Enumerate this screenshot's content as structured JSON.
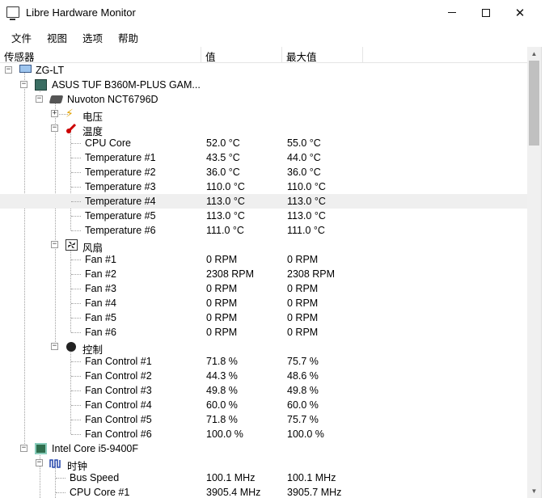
{
  "window": {
    "title": "Libre Hardware Monitor"
  },
  "menu": [
    "文件",
    "视图",
    "选项",
    "帮助"
  ],
  "columns": {
    "sensor": "传感器",
    "value": "值",
    "max": "最大值"
  },
  "tree": {
    "root": "ZG-LT",
    "motherboard": "ASUS TUF B360M-PLUS GAM...",
    "superio": "Nuvoton NCT6796D",
    "voltage_group": "电压",
    "temp_group": "温度",
    "temps": [
      {
        "name": "CPU Core",
        "value": "52.0 °C",
        "max": "55.0 °C"
      },
      {
        "name": "Temperature #1",
        "value": "43.5 °C",
        "max": "44.0 °C"
      },
      {
        "name": "Temperature #2",
        "value": "36.0 °C",
        "max": "36.0 °C"
      },
      {
        "name": "Temperature #3",
        "value": "110.0 °C",
        "max": "110.0 °C"
      },
      {
        "name": "Temperature #4",
        "value": "113.0 °C",
        "max": "113.0 °C"
      },
      {
        "name": "Temperature #5",
        "value": "113.0 °C",
        "max": "113.0 °C"
      },
      {
        "name": "Temperature #6",
        "value": "111.0 °C",
        "max": "111.0 °C"
      }
    ],
    "fan_group": "风扇",
    "fans": [
      {
        "name": "Fan #1",
        "value": "0 RPM",
        "max": "0 RPM"
      },
      {
        "name": "Fan #2",
        "value": "2308 RPM",
        "max": "2308 RPM"
      },
      {
        "name": "Fan #3",
        "value": "0 RPM",
        "max": "0 RPM"
      },
      {
        "name": "Fan #4",
        "value": "0 RPM",
        "max": "0 RPM"
      },
      {
        "name": "Fan #5",
        "value": "0 RPM",
        "max": "0 RPM"
      },
      {
        "name": "Fan #6",
        "value": "0 RPM",
        "max": "0 RPM"
      }
    ],
    "control_group": "控制",
    "controls": [
      {
        "name": "Fan Control #1",
        "value": "71.8 %",
        "max": "75.7 %"
      },
      {
        "name": "Fan Control #2",
        "value": "44.3 %",
        "max": "48.6 %"
      },
      {
        "name": "Fan Control #3",
        "value": "49.8 %",
        "max": "49.8 %"
      },
      {
        "name": "Fan Control #4",
        "value": "60.0 %",
        "max": "60.0 %"
      },
      {
        "name": "Fan Control #5",
        "value": "71.8 %",
        "max": "75.7 %"
      },
      {
        "name": "Fan Control #6",
        "value": "100.0 %",
        "max": "100.0 %"
      }
    ],
    "cpu": "Intel Core i5-9400F",
    "clock_group": "时钟",
    "clocks": [
      {
        "name": "Bus Speed",
        "value": "100.1 MHz",
        "max": "100.1 MHz"
      },
      {
        "name": "CPU Core #1",
        "value": "3905.4 MHz",
        "max": "3905.7 MHz"
      }
    ]
  },
  "colors": {
    "highlight_row": "#efefef",
    "tree_lines": "#a0a0a0"
  }
}
